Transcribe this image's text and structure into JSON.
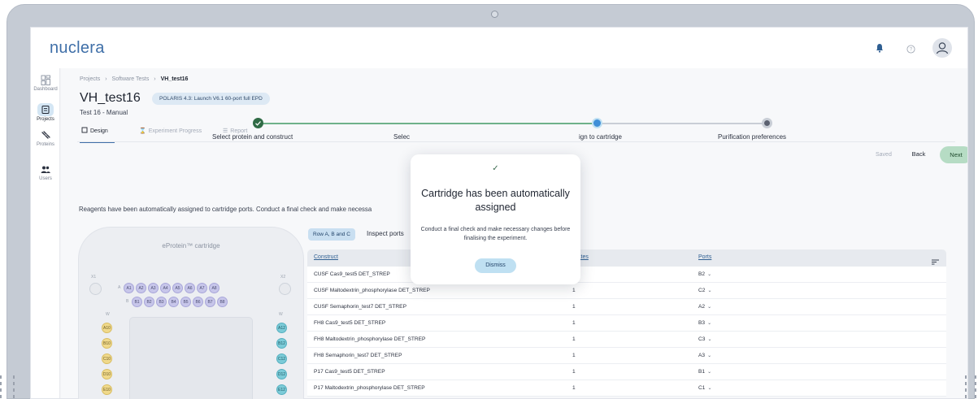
{
  "app": {
    "logo": "nuclera"
  },
  "sidebar": {
    "items": [
      {
        "label": "Dashboard",
        "icon": "dashboard-icon"
      },
      {
        "label": "Projects",
        "icon": "projects-icon"
      },
      {
        "label": "Proteins",
        "icon": "proteins-icon"
      },
      {
        "label": "Users",
        "icon": "users-icon"
      }
    ]
  },
  "breadcrumb": {
    "part1": "Projects",
    "sep": "›",
    "part2": "Software Tests",
    "current": "VH_test16"
  },
  "project": {
    "title": "VH_test16",
    "chip": "POLARIS 4.3: Launch V6.1 60-port full EPD",
    "subtitle": "Test 16 - Manual"
  },
  "tabs": [
    {
      "label": "Design",
      "icon": "design-icon"
    },
    {
      "label": "Experiment Progress",
      "icon": "hourglass-icon"
    },
    {
      "label": "Report",
      "icon": "report-icon"
    }
  ],
  "actions": {
    "saved": "Saved",
    "back": "Back",
    "next": "Next"
  },
  "steps": [
    {
      "label": "Select protein and construct",
      "status": "done"
    },
    {
      "label": "Selec",
      "status": "done"
    },
    {
      "label": "ign to cartridge",
      "status": "active"
    },
    {
      "label": "Purification preferences",
      "status": "pending"
    }
  ],
  "info_line": "Reagents have been automatically assigned to cartridge ports. Conduct a final check and make necessa",
  "cartridge": {
    "title": "eProtein™ cartridge",
    "tags": {
      "x1": "X1",
      "x2": "X2",
      "w1": "W",
      "w2": "W",
      "rowA": "A",
      "rowB": "B"
    },
    "row_a": [
      "A1",
      "A2",
      "A3",
      "A4",
      "A5",
      "A6",
      "A7",
      "A8"
    ],
    "row_b": [
      "B1",
      "B2",
      "B3",
      "B4",
      "B5",
      "B6",
      "B7",
      "B8"
    ],
    "left_col": [
      "A10",
      "B10",
      "C10",
      "D10",
      "E10"
    ],
    "right_col": [
      "A12",
      "B12",
      "C12",
      "D12",
      "E12"
    ],
    "colors": {
      "purple": "#c7c6ea",
      "yellow": "#f0d98b",
      "teal": "#7ccbd8"
    }
  },
  "table_controls": {
    "row_toggle": "Row A, B and C",
    "inspect": "Inspect ports"
  },
  "table": {
    "headers": {
      "construct": "Construct",
      "replicates": "licates",
      "ports": "Ports"
    },
    "rows": [
      {
        "construct": "CUSF Cas9_test5 DET_STREP",
        "replicates": "",
        "port": "B2"
      },
      {
        "construct": "CUSF Maltodextrin_phosphorylase DET_STREP",
        "replicates": "1",
        "port": "C2"
      },
      {
        "construct": "CUSF Semaphorin_test7 DET_STREP",
        "replicates": "1",
        "port": "A2"
      },
      {
        "construct": "FH8 Cas9_test5 DET_STREP",
        "replicates": "1",
        "port": "B3"
      },
      {
        "construct": "FH8 Maltodextrin_phosphorylase DET_STREP",
        "replicates": "1",
        "port": "C3"
      },
      {
        "construct": "FH8 Semaphorin_test7 DET_STREP",
        "replicates": "1",
        "port": "A3"
      },
      {
        "construct": "P17 Cas9_test5 DET_STREP",
        "replicates": "1",
        "port": "B1"
      },
      {
        "construct": "P17 Maltodextrin_phosphorylase DET_STREP",
        "replicates": "1",
        "port": "C1"
      }
    ]
  },
  "modal": {
    "check": "✓",
    "title": "Cartridge has been automatically assigned",
    "body": "Conduct a final check and make necessary changes before finalising the experiment.",
    "dismiss": "Dismiss"
  }
}
